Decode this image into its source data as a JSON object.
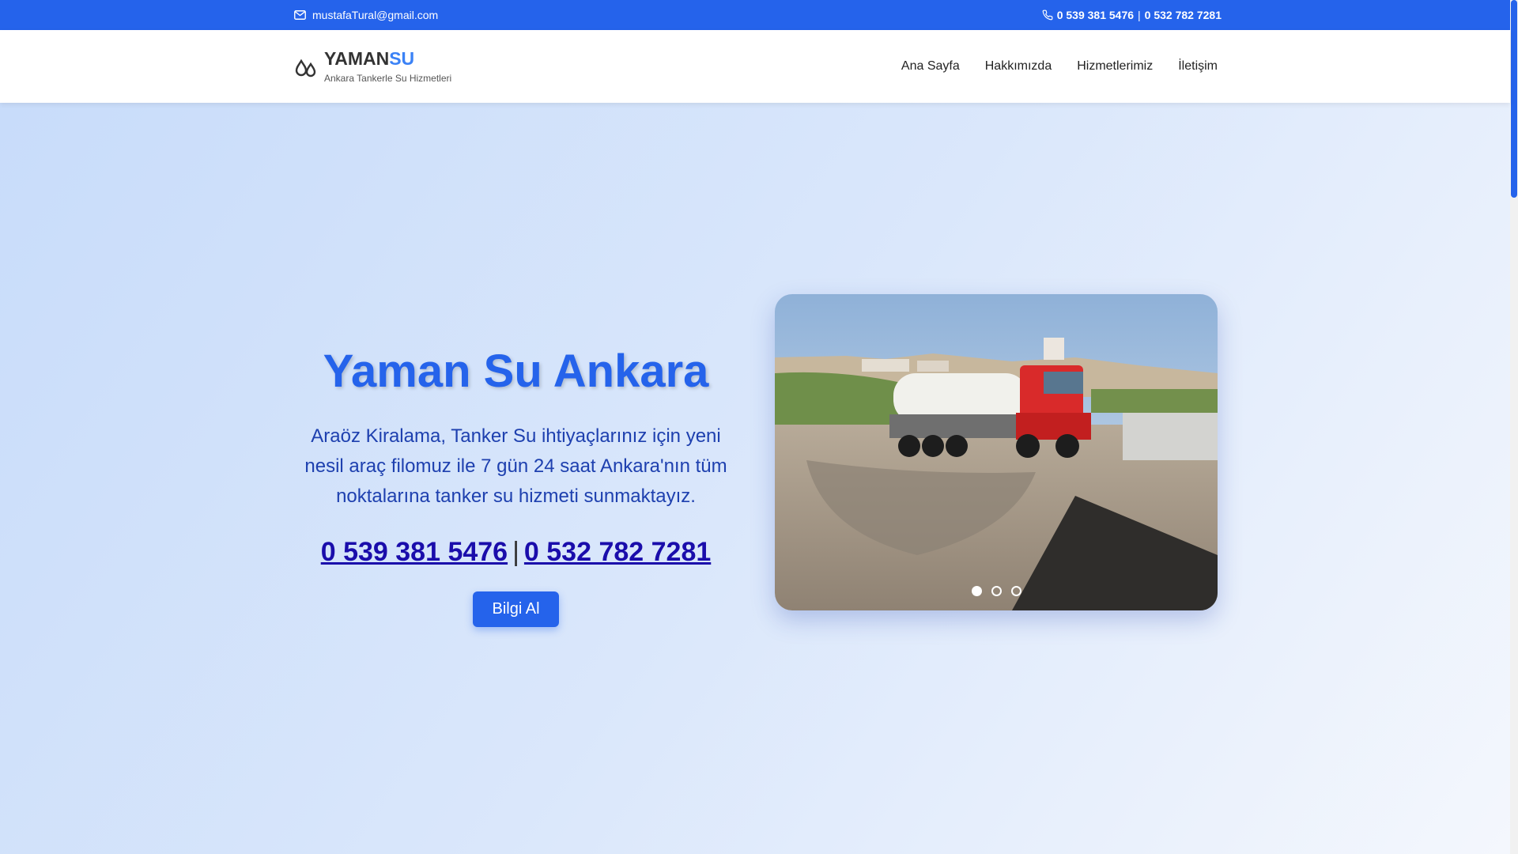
{
  "topbar": {
    "email": "mustafaTural@gmail.com",
    "phone1": "0 539 381 5476",
    "separator": "|",
    "phone2": "0 532 782 7281",
    "background_color": "#2563eb"
  },
  "header": {
    "brand_main": "YAMAN",
    "brand_accent": "SU",
    "tagline": "Ankara Tankerle Su Hizmetleri",
    "logo_icon": "water-drops-icon",
    "nav": [
      {
        "label": "Ana Sayfa"
      },
      {
        "label": "Hakkımızda"
      },
      {
        "label": "Hizmetlerimiz"
      },
      {
        "label": "İletişim"
      }
    ]
  },
  "hero": {
    "title": "Yaman Su Ankara",
    "description": "Araöz Kiralama, Tanker Su ihtiyaçlarınız için yeni nesil araç filomuz ile 7 gün 24 saat Ankara'nın tüm noktalarına tanker su hizmeti sunmaktayız.",
    "phone1": "0 539 381 5476",
    "separator": "|",
    "phone2": "0 532 782 7281",
    "cta_label": "Bilgi Al",
    "accent_color": "#2563eb"
  },
  "slider": {
    "image_subject": "red tanker truck",
    "slide_count": 3,
    "active_slide": 1
  }
}
